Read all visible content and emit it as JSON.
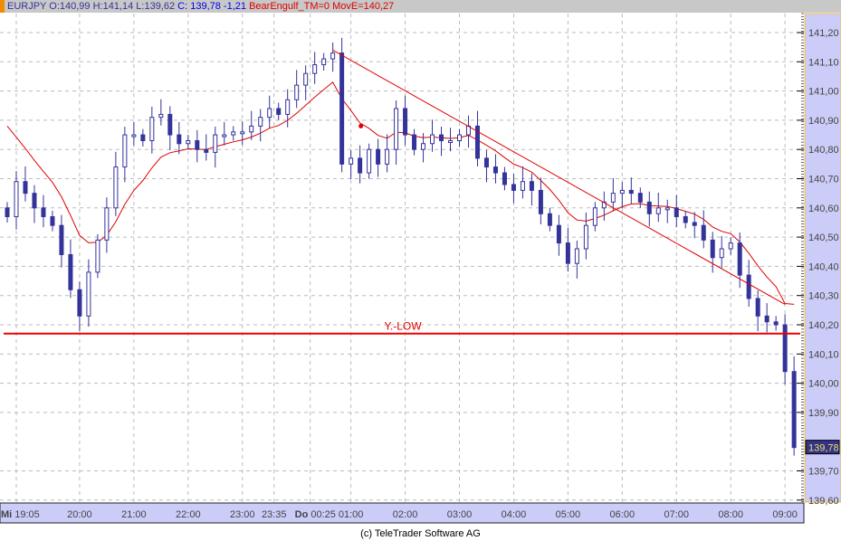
{
  "header": {
    "symbol": "EURJPY",
    "ohlc": "O:140,99 H:141,14 L:139,62",
    "close": "C: 139,78 -1,21",
    "indicator": "BearEngulf_TM=0 MovE=140,27"
  },
  "footer": "(c) TeleTrader Software AG",
  "colors": {
    "candle": "#33339a",
    "ma": "#e00000",
    "axis_bg": "#ccccf8"
  },
  "chart_data": {
    "type": "candlestick",
    "title": "EURJPY",
    "yticks": [
      "141,20",
      "141,10",
      "141,00",
      "140,90",
      "140,80",
      "140,70",
      "140,60",
      "140,50",
      "140,40",
      "140,30",
      "140,20",
      "140,10",
      "140,00",
      "139,90",
      "139,70",
      "139,60"
    ],
    "ytick_values": [
      141.2,
      141.1,
      141.0,
      140.9,
      140.8,
      140.7,
      140.6,
      140.5,
      140.4,
      140.3,
      140.2,
      140.1,
      140.0,
      139.9,
      139.7,
      139.6
    ],
    "ylim": [
      139.6,
      141.27
    ],
    "xticks": [
      {
        "label": "Mi",
        "bold": true,
        "label2": "19:05",
        "i": 1
      },
      {
        "label": "20:00",
        "i": 8
      },
      {
        "label": "21:00",
        "i": 14
      },
      {
        "label": "22:00",
        "i": 20
      },
      {
        "label": "23:00",
        "i": 26
      },
      {
        "label": "23:35",
        "i": 29.5
      },
      {
        "label": "Do",
        "bold": true,
        "label2": "00:25",
        "i": 33.5
      },
      {
        "label": "01:00",
        "i": 38
      },
      {
        "label": "02:00",
        "i": 44
      },
      {
        "label": "03:00",
        "i": 50
      },
      {
        "label": "04:00",
        "i": 56
      },
      {
        "label": "05:00",
        "i": 62
      },
      {
        "label": "06:00",
        "i": 68
      },
      {
        "label": "07:00",
        "i": 74
      },
      {
        "label": "08:00",
        "i": 80
      },
      {
        "label": "09:00",
        "i": 86
      }
    ],
    "closes": [
      140.57,
      140.69,
      140.65,
      140.6,
      140.57,
      140.54,
      140.44,
      140.32,
      140.23,
      140.38,
      140.49,
      140.6,
      140.74,
      140.85,
      140.85,
      140.83,
      140.91,
      140.92,
      140.85,
      140.82,
      140.83,
      140.8,
      140.79,
      140.85,
      140.85,
      140.86,
      140.86,
      140.88,
      140.91,
      140.94,
      140.92,
      140.97,
      141.02,
      141.06,
      141.09,
      141.11,
      141.13,
      140.75,
      140.77,
      140.72,
      140.8,
      140.75,
      140.8,
      140.94,
      140.85,
      140.8,
      140.82,
      140.85,
      140.83,
      140.83,
      140.85,
      140.88,
      140.77,
      140.74,
      140.72,
      140.68,
      140.66,
      140.69,
      140.66,
      140.58,
      140.54,
      140.48,
      140.41,
      140.46,
      140.54,
      140.6,
      140.62,
      140.65,
      140.66,
      140.65,
      140.62,
      140.58,
      140.6,
      140.6,
      140.57,
      140.55,
      140.54,
      140.49,
      140.43,
      140.46,
      140.48,
      140.37,
      140.29,
      140.23,
      140.21,
      140.2,
      140.04,
      139.78
    ],
    "last_price": "139,78",
    "trendline": {
      "from": {
        "i": 36,
        "price": 141.14
      },
      "to": {
        "i": 86,
        "price": 140.27
      }
    },
    "support": {
      "label": "Y.-LOW",
      "price": 140.17
    },
    "signal": {
      "i": 39,
      "price": 140.88
    },
    "ma_label": "MovE"
  }
}
